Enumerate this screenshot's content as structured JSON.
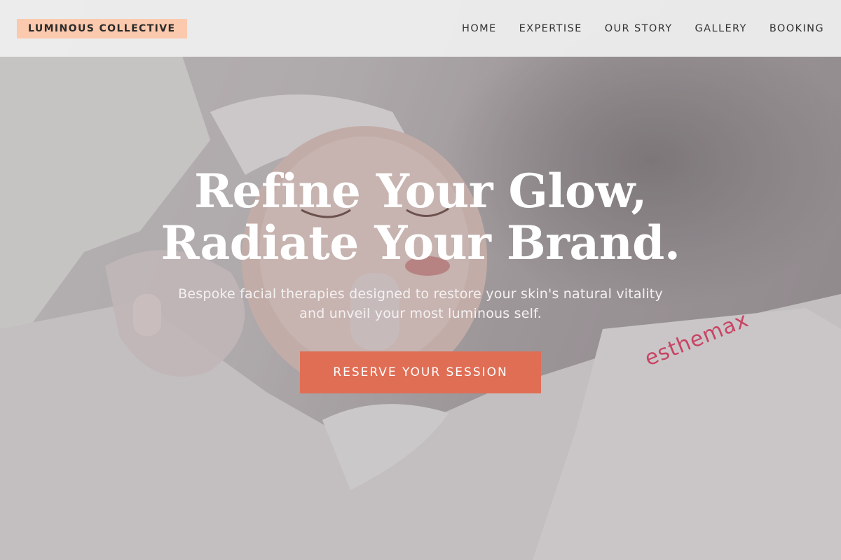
{
  "brand": {
    "name": "LUMINOUS COLLECTIVE"
  },
  "nav": {
    "items": [
      {
        "label": "HOME"
      },
      {
        "label": "EXPERTISE"
      },
      {
        "label": "OUR STORY"
      },
      {
        "label": "GALLERY"
      },
      {
        "label": "BOOKING"
      }
    ]
  },
  "hero": {
    "headline_line1": "Refine Your Glow,",
    "headline_line2": "Radiate Your Brand.",
    "subtext": "Bespoke facial therapies designed to restore your skin's natural vitality and unveil your most luminous self.",
    "cta_label": "RESERVE YOUR SESSION",
    "towel_text": "esthemax"
  },
  "colors": {
    "brand_badge": "#fbc9ad",
    "cta": "#e06e55",
    "nav_bg": "#f0f0f0"
  }
}
